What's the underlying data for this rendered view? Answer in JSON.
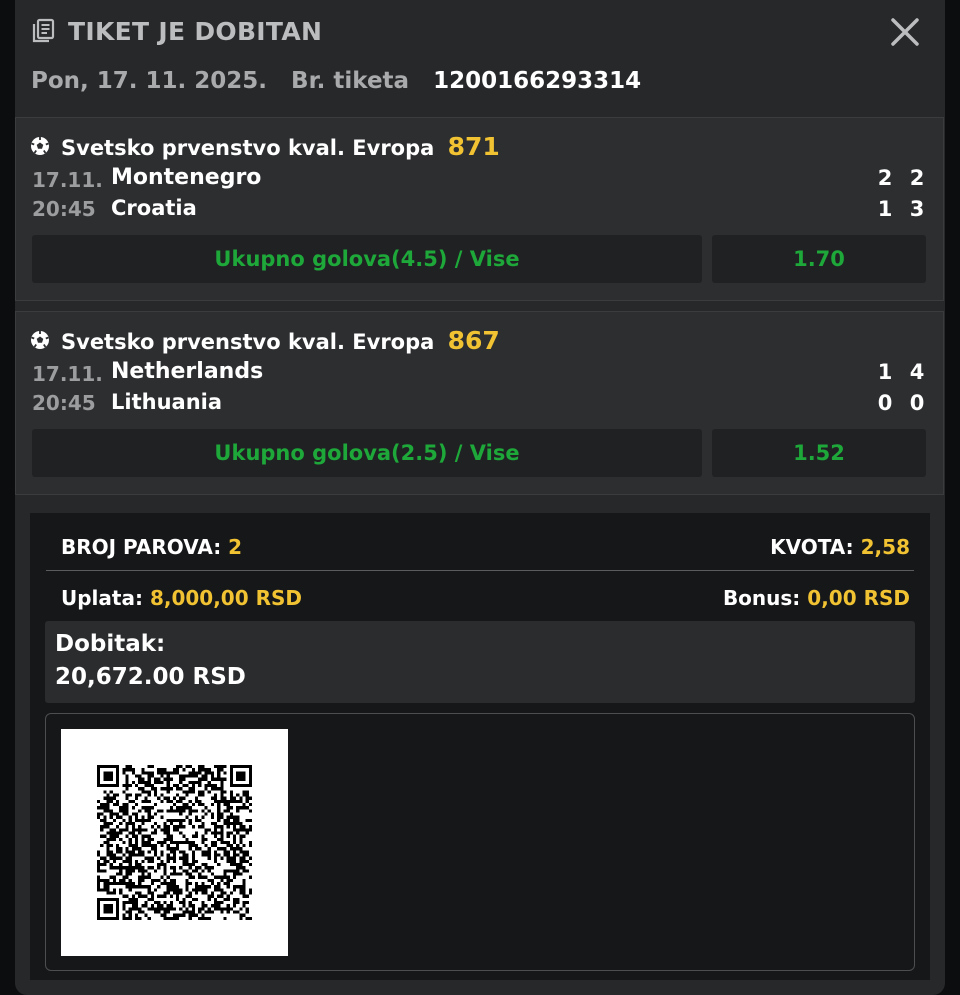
{
  "header": {
    "title": "TIKET JE DOBITAN",
    "date": "Pon, 17. 11. 2025.",
    "ticket_label": "Br. tiketa",
    "ticket_number": "1200166293314"
  },
  "matches": [
    {
      "league": "Svetsko prvenstvo kval. Evropa",
      "code": "871",
      "date": "17.11.",
      "time": "20:45",
      "home": "Montenegro",
      "away": "Croatia",
      "home_score_1": "2",
      "home_score_2": "2",
      "away_score_1": "1",
      "away_score_2": "3",
      "pick": "Ukupno golova(4.5) / Vise",
      "odd": "1.70"
    },
    {
      "league": "Svetsko prvenstvo kval. Evropa",
      "code": "867",
      "date": "17.11.",
      "time": "20:45",
      "home": "Netherlands",
      "away": "Lithuania",
      "home_score_1": "1",
      "home_score_2": "4",
      "away_score_1": "0",
      "away_score_2": "0",
      "pick": "Ukupno golova(2.5) / Vise",
      "odd": "1.52"
    }
  ],
  "summary": {
    "pairs_label": "BROJ PAROVA:",
    "pairs_value": "2",
    "odds_label": "KVOTA:",
    "odds_value": "2,58",
    "stake_label": "Uplata:",
    "stake_value": "8,000,00 RSD",
    "bonus_label": "Bonus:",
    "bonus_value": "0,00 RSD",
    "win_label": "Dobitak:",
    "win_value": "20,672.00 RSD"
  },
  "colors": {
    "accent_yellow": "#f1c232",
    "pick_green": "#1fa83a",
    "panel": "#26282a",
    "background": "#0c0d0e"
  },
  "icons": {
    "title": "document-list-icon",
    "close": "close-icon",
    "sport": "soccer-ball-icon",
    "qr": "qr-code"
  }
}
